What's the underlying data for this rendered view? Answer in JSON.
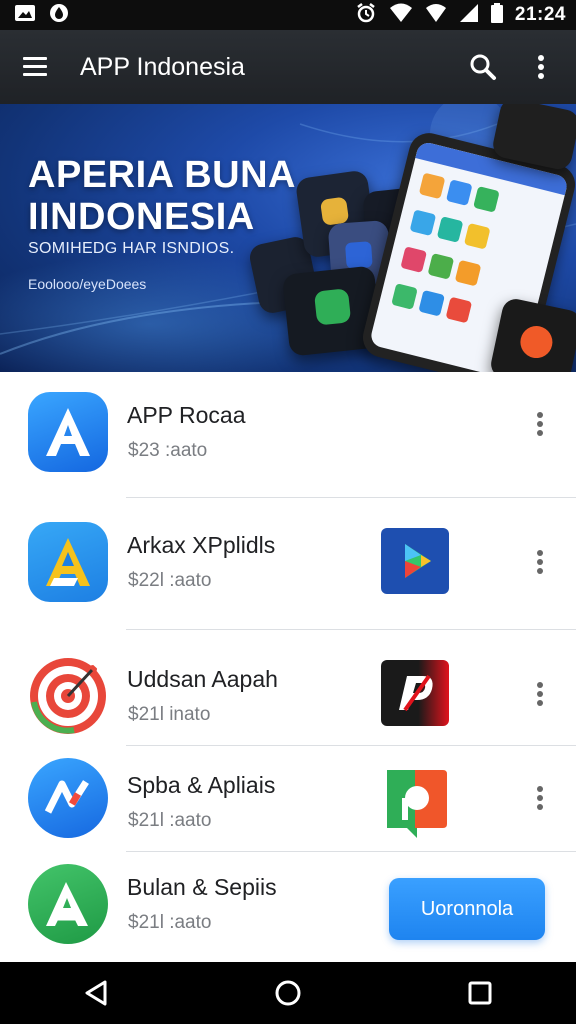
{
  "status_bar": {
    "time": "21:24"
  },
  "app_bar": {
    "title": "APP Indonesia"
  },
  "banner": {
    "headline_line1": "APERIA BUNA",
    "headline_line2": "IINDONESIA",
    "subtitle": "SOMIHEDG HAR ISNDIOS.",
    "tagline": "Eoolooo/eyeDoees"
  },
  "apps": [
    {
      "name": "APP Rocaa",
      "price": "$23 :aato",
      "icon": "blue-a-icon",
      "thumb": null
    },
    {
      "name": "Arkax XPplidls",
      "price": "$22l :aato",
      "icon": "yellow-a-icon",
      "thumb": "play-store-icon"
    },
    {
      "name": "Uddsan Aapah",
      "price": "$21l inato",
      "icon": "target-icon",
      "thumb": "p-logo-icon"
    },
    {
      "name": "Spba & Apliais",
      "price": "$21l :aato",
      "icon": "n-arrow-icon",
      "thumb": "chat-bubble-icon"
    },
    {
      "name": "Bulan & Sepiis",
      "price": "$21l :aato",
      "icon": "green-a-icon",
      "thumb": null
    }
  ],
  "install_button": {
    "label": "Uoronnola"
  },
  "colors": {
    "app_bar": "#23272b",
    "banner": "#1e4aa8",
    "accent_button": "#2a90f5",
    "divider": "#dcdfe3"
  },
  "icons": {
    "menu": "hamburger-icon",
    "search": "search-icon",
    "overflow": "more-vert-icon",
    "nav_back": "back-triangle-icon",
    "nav_home": "home-circle-icon",
    "nav_recent": "recent-square-icon"
  }
}
